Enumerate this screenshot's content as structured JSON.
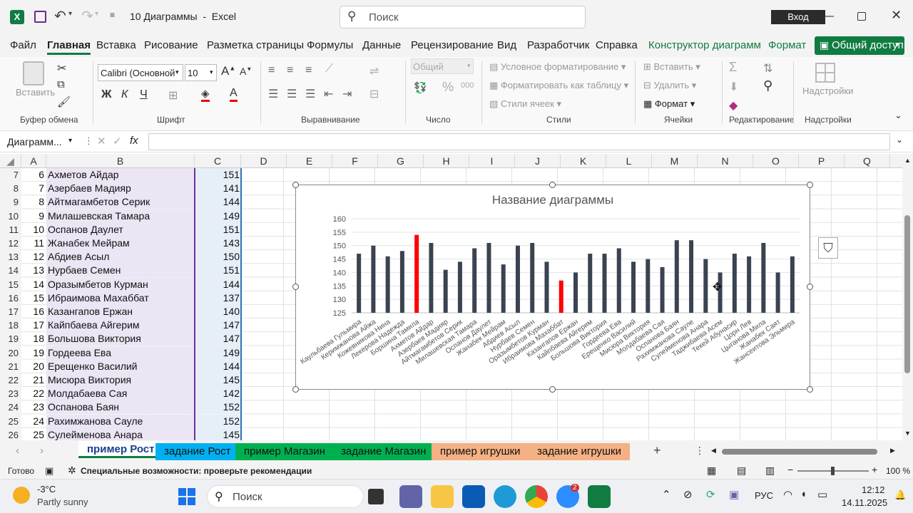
{
  "window": {
    "title": "10 Диаграммы  -  Excel",
    "search_placeholder": "Поиск",
    "signin": "Вход"
  },
  "menu": {
    "items": [
      "Файл",
      "Главная",
      "Вставка",
      "Рисование",
      "Разметка страницы",
      "Формулы",
      "Данные",
      "Рецензирование",
      "Вид",
      "Разработчик",
      "Справка",
      "Конструктор диаграмм",
      "Формат"
    ],
    "share": "Общий доступ"
  },
  "ribbon": {
    "paste": "Вставить",
    "font_name": "Calibri (Основной т",
    "font_size": "10",
    "number_format": "Общий",
    "cond_format": "Условное форматирование",
    "format_table": "Форматировать как таблицу",
    "cell_styles": "Стили ячеек",
    "insert": "Вставить",
    "delete": "Удалить",
    "format": "Формат",
    "addins": "Надстройки",
    "groups": {
      "clipboard": "Буфер обмена",
      "font": "Шрифт",
      "alignment": "Выравнивание",
      "number": "Число",
      "styles": "Стили",
      "cells": "Ячейки",
      "editing": "Редактирование",
      "addins": "Надстройки"
    }
  },
  "formula_bar": {
    "name_box": "Диаграмм...",
    "fx": "fx",
    "value": ""
  },
  "columns": [
    "A",
    "B",
    "C",
    "D",
    "E",
    "F",
    "G",
    "H",
    "I",
    "J",
    "K",
    "L",
    "M",
    "N",
    "O",
    "P",
    "Q"
  ],
  "rows": [
    {
      "num": "7",
      "a": "6",
      "b": "Ахметов Айдар",
      "c": "151"
    },
    {
      "num": "8",
      "a": "7",
      "b": "Азербаев Мадияр",
      "c": "141"
    },
    {
      "num": "9",
      "a": "8",
      "b": "Айтмагамбетов Серик",
      "c": "144"
    },
    {
      "num": "10",
      "a": "9",
      "b": "Милашевская Тамара",
      "c": "149"
    },
    {
      "num": "11",
      "a": "10",
      "b": "Оспанов Даулет",
      "c": "151"
    },
    {
      "num": "12",
      "a": "11",
      "b": "Жанабек Мейрам",
      "c": "143"
    },
    {
      "num": "13",
      "a": "12",
      "b": "Абдиев Асыл",
      "c": "150"
    },
    {
      "num": "14",
      "a": "13",
      "b": "Нурбаев Семен",
      "c": "151"
    },
    {
      "num": "15",
      "a": "14",
      "b": "Оразымбетов Курман",
      "c": "144"
    },
    {
      "num": "16",
      "a": "15",
      "b": "Ибраимова Махаббат",
      "c": "137"
    },
    {
      "num": "17",
      "a": "16",
      "b": "Казангапов Ержан",
      "c": "140"
    },
    {
      "num": "18",
      "a": "17",
      "b": "Кайпбаева Айгерим",
      "c": "147"
    },
    {
      "num": "19",
      "a": "18",
      "b": "Большова Виктория",
      "c": "147"
    },
    {
      "num": "20",
      "a": "19",
      "b": "Гордеева Ева",
      "c": "149"
    },
    {
      "num": "21",
      "a": "20",
      "b": "Ерещенко Василий",
      "c": "144"
    },
    {
      "num": "22",
      "a": "21",
      "b": "Мисюра Виктория",
      "c": "145"
    },
    {
      "num": "23",
      "a": "22",
      "b": "Молдабаева Сая",
      "c": "142"
    },
    {
      "num": "24",
      "a": "23",
      "b": "Оспанова Баян",
      "c": "152"
    },
    {
      "num": "25",
      "a": "24",
      "b": "Рахимжанова Сауле",
      "c": "152"
    },
    {
      "num": "26",
      "a": "25",
      "b": "Сулейменова Анара",
      "c": "145"
    }
  ],
  "chart_data": {
    "type": "bar",
    "title": "Название диаграммы",
    "ylim": [
      125,
      160
    ],
    "yticks": [
      125,
      130,
      135,
      140,
      145,
      150,
      155,
      160
    ],
    "grid": true,
    "categories": [
      "Каульбаева Гульмира",
      "Керимжанова Айжа",
      "Кожевникова Нина",
      "Лекерова Надежда",
      "Боршина Тамила",
      "Ахметов Айдар",
      "Азербаев Мадияр",
      "Айтмагамбетов Серик",
      "Милашевская Тамара",
      "Оспанов Даулет",
      "Жанабек Мейрам",
      "Абдиев Асыл",
      "Нурбаев Семен",
      "Оразымбетов Курман",
      "Ибраимова Махаббат",
      "Казангапов Ержан",
      "Кайпбаева Айгерим",
      "Большова Виктория",
      "Гордеева Ева",
      "Ерещенко Василий",
      "Мисюра Виктория",
      "Молдабаева Сая",
      "Оспанова Баян",
      "Рахимжанова Сауле",
      "Сулейменова Анара",
      "Таджибаева Асем",
      "Текей Абунасир",
      "Цорн Лев",
      "Цыганова Мила",
      "Жанабек Саят",
      "Жансеитова Эльмира"
    ],
    "values": [
      147,
      150,
      146,
      148,
      154,
      151,
      141,
      144,
      149,
      151,
      143,
      150,
      151,
      144,
      137,
      140,
      147,
      147,
      149,
      144,
      145,
      142,
      152,
      152,
      145,
      140,
      147,
      146,
      151,
      140,
      146
    ],
    "highlight_indices": [
      4,
      14
    ],
    "bar_color": "#3a4350",
    "highlight_color": "#ff0000"
  },
  "sheets": [
    "пример Рост",
    "задание Рост",
    "пример Магазин",
    "задание Магазин",
    "пример игрушки",
    "задание игрушки"
  ],
  "status": {
    "ready": "Готово",
    "accessibility": "Специальные возможности: проверьте рекомендации",
    "zoom": "100 %"
  },
  "taskbar": {
    "weather_temp": "-3°C",
    "weather_desc": "Partly sunny",
    "search": "Поиск",
    "lang": "РУС",
    "time": "12:12",
    "date": "14.11.2025",
    "notif_count": "2"
  },
  "colors": {
    "excel_green": "#107c41",
    "accent": "#1e7145"
  }
}
